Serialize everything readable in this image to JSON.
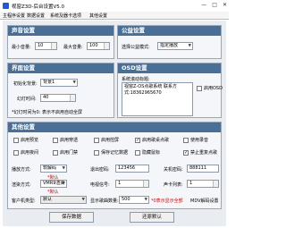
{
  "window": {
    "title": "视窗Z3D-后台设置V5.0",
    "minimize": "—",
    "maximize": "□",
    "close": "✕"
  },
  "tabs": [
    "主程序设置",
    "数据设置",
    "系统及器卡选项",
    "其他设置"
  ],
  "sound": {
    "header": "声音设置",
    "min_volume_label": "最小音量:",
    "min_volume": "10",
    "max_volume_label": "最大音量:",
    "max_volume": "100"
  },
  "ad": {
    "header": "公益设置",
    "mode_label": "选择公益模式:",
    "mode_value": "指定播放"
  },
  "screen": {
    "header": "界面设置",
    "bg_label": "初始化背景:",
    "bg_value": "背景1",
    "idle_label": "幻灯时间:",
    "idle_value": "40",
    "note": "*幻灯时间为0: 表示不启用自动全屏"
  },
  "osd": {
    "header": "OSD设置",
    "scroll_label": "系统滚动标题:",
    "scroll_text": "视窗Z-OS点歌系统 联系方式:18362965670",
    "enable_osd_label": "启用OSD"
  },
  "other": {
    "header": "其他设置",
    "row1": [
      {
        "label": "启用预览",
        "checked": false
      },
      {
        "label": "启用穿透",
        "checked": false
      },
      {
        "label": "启用控屏",
        "checked": false
      },
      {
        "label": "启用歌桌点歌",
        "checked": true
      },
      {
        "label": "使用录音",
        "checked": false
      }
    ],
    "row2": [
      {
        "label": "启用夜间",
        "checked": false
      },
      {
        "label": "启用门禁",
        "checked": false
      },
      {
        "label": "保存记忆数据",
        "checked": false
      },
      {
        "label": "隐藏鼠标",
        "checked": false
      },
      {
        "label": "禁止重复点歌",
        "checked": true
      }
    ],
    "play_mode_label": "播放方式:",
    "play_mode_value": "软解码",
    "play_mode_note": "*默认",
    "code_label": "退出密码:",
    "code_value": "123456",
    "dev_label": "关机密码:",
    "dev_value": "888111",
    "render_label": "渲染方式:",
    "render_value": "VMR9渲染",
    "render_note": "*默认",
    "tv_label": "电视信号:",
    "tv_value": "1",
    "channel_label": "声卡列表:",
    "channel_value": "1",
    "client_label": "客户机类型:",
    "client_value": "默认",
    "limit_label": "显示歌曲数量:",
    "limit_value": "500",
    "limit_note": "*0表示显示全部",
    "mdv_label": "MDV解码设置"
  },
  "footer": {
    "save_label": "保存数据",
    "restore_label": "还原默认"
  }
}
